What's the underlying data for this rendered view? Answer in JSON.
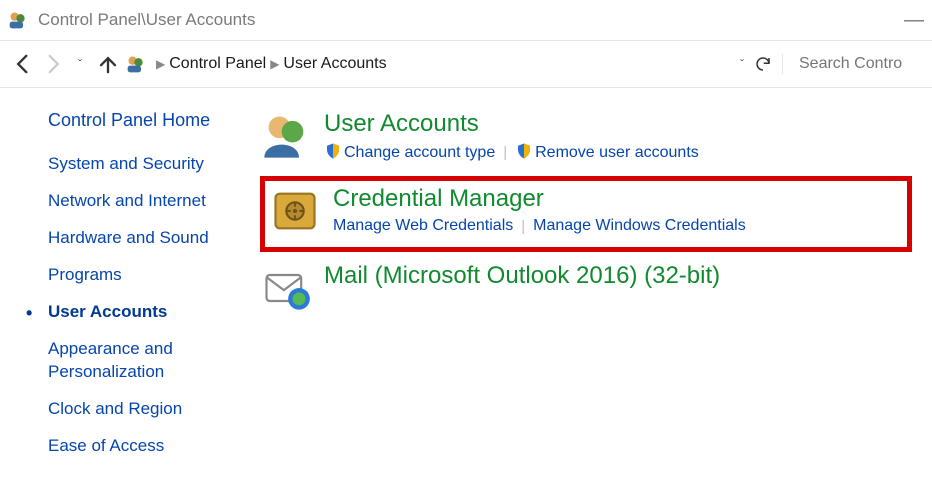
{
  "window": {
    "title": "Control Panel\\User Accounts"
  },
  "addressbar": {
    "seg1": "Control Panel",
    "seg2": "User Accounts"
  },
  "search": {
    "placeholder": "Search Contro"
  },
  "sidebar": {
    "home": "Control Panel Home",
    "items": [
      {
        "label": "System and Security"
      },
      {
        "label": "Network and Internet"
      },
      {
        "label": "Hardware and Sound"
      },
      {
        "label": "Programs"
      },
      {
        "label": "User Accounts",
        "active": true
      },
      {
        "label": "Appearance and Personalization"
      },
      {
        "label": "Clock and Region"
      },
      {
        "label": "Ease of Access"
      }
    ]
  },
  "categories": {
    "userAccounts": {
      "title": "User Accounts",
      "link1": "Change account type",
      "link2": "Remove user accounts"
    },
    "credentialManager": {
      "title": "Credential Manager",
      "link1": "Manage Web Credentials",
      "link2": "Manage Windows Credentials"
    },
    "mail": {
      "title": "Mail (Microsoft Outlook 2016) (32-bit)"
    }
  }
}
